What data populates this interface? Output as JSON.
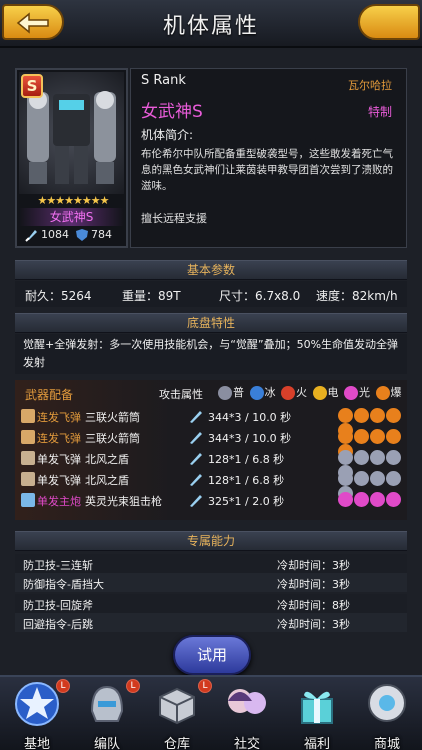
{
  "header": {
    "title": "机体属性"
  },
  "card": {
    "rank_letter": "S",
    "stars": "★★★★★★★★",
    "name": "女武神S",
    "attack": "1084",
    "defense": "784"
  },
  "info": {
    "rank": "S Rank",
    "faction": "瓦尔哈拉",
    "name": "女武神S",
    "tag": "特制",
    "intro_label": "机体简介:",
    "description": "布伦希尔中队所配备重型破袭型号，这些敢发着死亡气息的黑色女武神们让莱茵装甲教导团首次尝到了溃败的滋味。",
    "skill": "擅长远程支援"
  },
  "basic": {
    "title": "基本参数",
    "durability": "耐久：5264",
    "weight": "重量：89T",
    "size": "尺寸：6.7x8.0",
    "speed": "速度：82km/h"
  },
  "chassis": {
    "title": "底盘特性",
    "text": "觉醒+全弹发射：多一次使用技能机会，与“觉醒”叠加；50%生命值发动全弹发射"
  },
  "weapons": {
    "title": "武器配备",
    "attr_label": "攻击属性",
    "legend": [
      {
        "label": "普",
        "color": "#8a8ea0"
      },
      {
        "label": "冰",
        "color": "#3a7fd8"
      },
      {
        "label": "火",
        "color": "#d8402a"
      },
      {
        "label": "电",
        "color": "#e8b020"
      },
      {
        "label": "光",
        "color": "#e04ac8"
      },
      {
        "label": "爆",
        "color": "#e8801c"
      }
    ],
    "rows": [
      {
        "type": "连发飞弹",
        "type_color": "#e39b3c",
        "name": "三联火箭筒",
        "stat": "344*3 / 10.0 秒",
        "dot_color": "#e8801c"
      },
      {
        "type": "连发飞弹",
        "type_color": "#e39b3c",
        "name": "三联火箭筒",
        "stat": "344*3 / 10.0 秒",
        "dot_color": "#e8801c"
      },
      {
        "type": "单发飞弹",
        "type_color": "#f0f0f0",
        "name": "北风之盾",
        "stat": "128*1 / 6.8 秒",
        "dot_color": "#9aa0b4"
      },
      {
        "type": "单发飞弹",
        "type_color": "#f0f0f0",
        "name": "北风之盾",
        "stat": "128*1 / 6.8 秒",
        "dot_color": "#9aa0b4"
      },
      {
        "type": "单发主炮",
        "type_color": "#e04ac8",
        "name": "英灵光束狙击枪",
        "stat": "325*1 / 2.0 秒",
        "dot_color": "#e04ac8"
      }
    ]
  },
  "exclusive": {
    "title": "专属能力",
    "rows": [
      {
        "name": "防卫技-三连斩",
        "cd": "冷却时间：3秒"
      },
      {
        "name": "防御指令-盾挡大",
        "cd": "冷却时间：3秒"
      },
      {
        "name": "防卫技-回旋斧",
        "cd": "冷却时间：8秒"
      },
      {
        "name": "回避指令-后跳",
        "cd": "冷却时间：3秒"
      }
    ]
  },
  "trial_button": "试用",
  "nav": [
    {
      "label": "基地",
      "icon": "star-icon"
    },
    {
      "label": "编队",
      "icon": "helmet-icon"
    },
    {
      "label": "仓库",
      "icon": "crate-icon"
    },
    {
      "label": "社交",
      "icon": "characters-icon"
    },
    {
      "label": "福利",
      "icon": "gift-icon"
    },
    {
      "label": "商城",
      "icon": "shop-robot-icon"
    }
  ],
  "nav_badge": "L"
}
